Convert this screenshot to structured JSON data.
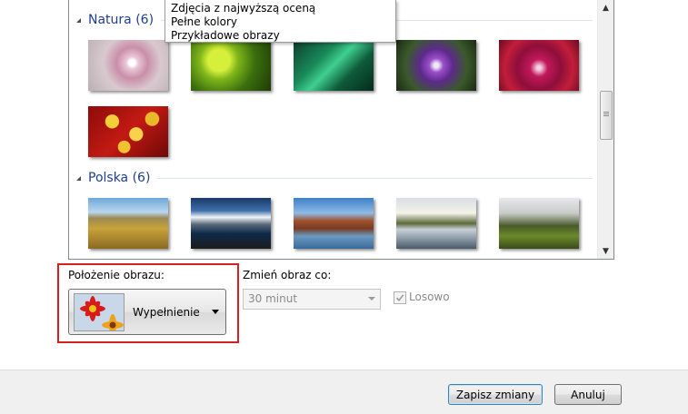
{
  "popup": {
    "options": [
      "Zdjęcia z najwyższą oceną",
      "Pełne kolory",
      "Przykładowe obrazy"
    ]
  },
  "groups": [
    {
      "title": "Natura (6)"
    },
    {
      "title": "Polska (6)"
    }
  ],
  "position": {
    "label": "Położenie obrazu:",
    "value": "Wypełnienie"
  },
  "change": {
    "label": "Zmień obraz co:",
    "value": "30 minut"
  },
  "shuffle": {
    "label": "Losowo",
    "checked": true
  },
  "footer": {
    "save_label": "Zapisz zmiany",
    "cancel_label": "Anuluj"
  },
  "colors": {
    "group_title": "#1e3f8a",
    "highlight_border": "#d81e1e"
  }
}
